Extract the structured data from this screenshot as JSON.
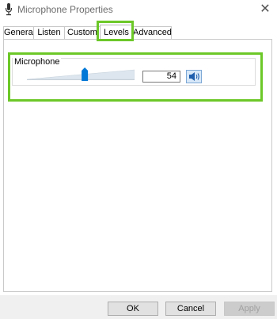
{
  "window": {
    "title": "Microphone Properties",
    "close_glyph": "✕"
  },
  "tabs": [
    {
      "label": "General"
    },
    {
      "label": "Listen"
    },
    {
      "label": "Custom"
    },
    {
      "label": "Levels",
      "selected": true
    },
    {
      "label": "Advanced"
    }
  ],
  "levels": {
    "group_label": "Microphone",
    "volume_value": "54",
    "slider_level_percent": 54
  },
  "buttons": {
    "ok": "OK",
    "cancel": "Cancel",
    "apply": "Apply"
  },
  "colors": {
    "highlight": "#6cc828",
    "accent": "#0078d7"
  },
  "icons": {
    "title": "microphone-icon",
    "speaker": "speaker-icon",
    "close": "close-icon"
  }
}
